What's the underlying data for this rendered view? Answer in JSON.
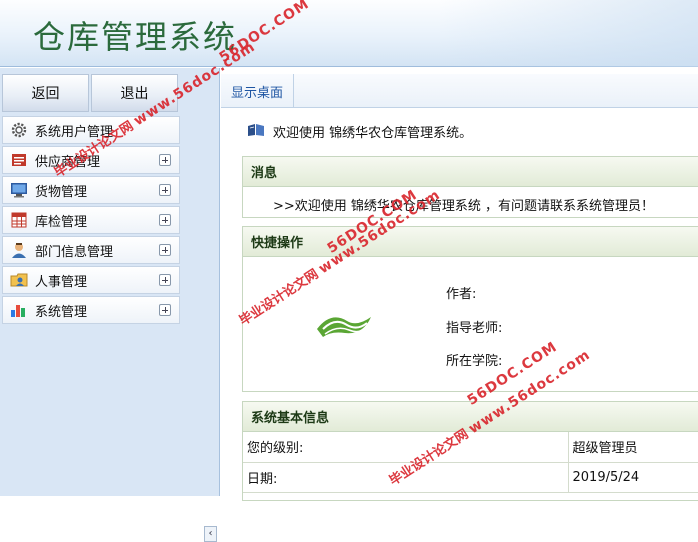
{
  "header": {
    "title": "仓库管理系统"
  },
  "sidebar": {
    "buttons": {
      "back": "返回",
      "logout": "退出"
    },
    "items": [
      {
        "label": "系统用户管理",
        "icon": "gear-icon",
        "expandable": false
      },
      {
        "label": "供应商管理",
        "icon": "supplier-book-icon",
        "expandable": true
      },
      {
        "label": "货物管理",
        "icon": "monitor-icon",
        "expandable": true
      },
      {
        "label": "库检管理",
        "icon": "grid-table-icon",
        "expandable": true
      },
      {
        "label": "部门信息管理",
        "icon": "users-icon",
        "expandable": true
      },
      {
        "label": "人事管理",
        "icon": "folder-user-icon",
        "expandable": true
      },
      {
        "label": "系统管理",
        "icon": "bar-chart-icon",
        "expandable": true
      }
    ],
    "collapse_label": "‹"
  },
  "main": {
    "tab": "显示桌面",
    "welcome": "欢迎使用  锦绣华农仓库管理系统。",
    "messages": {
      "title": "消息",
      "text": ">>欢迎使用  锦绣华农仓库管理系统 ，有问题请联系系统管理员！"
    },
    "quick": {
      "title": "快捷操作",
      "author_label": "作者:",
      "teacher_label": "指导老师:",
      "school_label": "所在学院:"
    },
    "sysinfo": {
      "title": "系统基本信息",
      "rows": [
        {
          "label": "您的级别:",
          "value": "超级管理员"
        },
        {
          "label": "日期:",
          "value": "2019/5/24"
        }
      ]
    }
  },
  "watermark": {
    "cn": "毕业设计论文网",
    "en": "www.56doc.com",
    "top": "56DOC.COM",
    "mid": "56DOC.COM"
  },
  "colors": {
    "title_green": "#2b6a3c",
    "tab_blue": "#1f56a3",
    "watermark_red": "#d9242b"
  }
}
